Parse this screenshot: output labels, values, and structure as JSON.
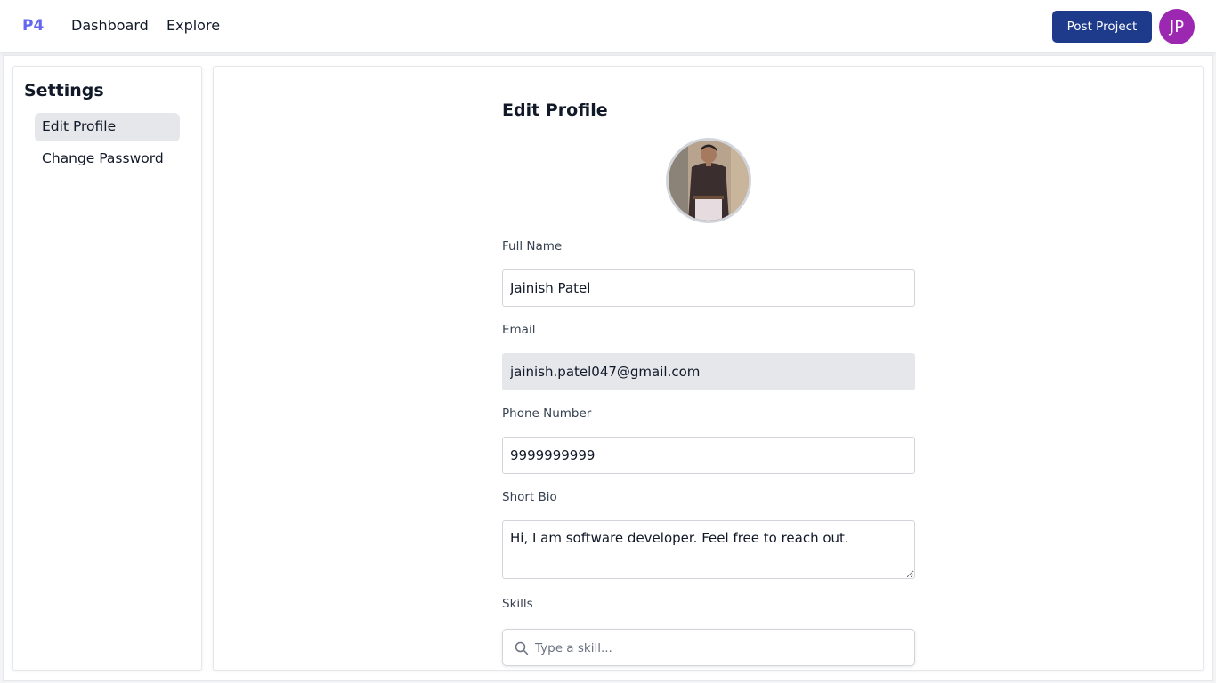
{
  "navbar": {
    "logo": "P4",
    "links": [
      "Dashboard",
      "Explore"
    ],
    "post_button": "Post Project",
    "avatar_initials": "JP",
    "avatar_color": "#9c27b0",
    "accent_color": "#1e3a8a"
  },
  "sidebar": {
    "title": "Settings",
    "items": [
      {
        "label": "Edit Profile",
        "active": true
      },
      {
        "label": "Change Password",
        "active": false
      }
    ]
  },
  "form": {
    "title": "Edit Profile",
    "photo_icon": "profile-photo",
    "full_name": {
      "label": "Full Name",
      "value": "Jainish Patel"
    },
    "email": {
      "label": "Email",
      "value": "jainish.patel047@gmail.com",
      "disabled": true
    },
    "phone": {
      "label": "Phone Number",
      "value": "9999999999"
    },
    "bio": {
      "label": "Short Bio",
      "value": "Hi, I am software developer. Feel free to reach out."
    },
    "skills": {
      "label": "Skills",
      "placeholder": "Type a skill...",
      "icon": "search-icon"
    }
  }
}
